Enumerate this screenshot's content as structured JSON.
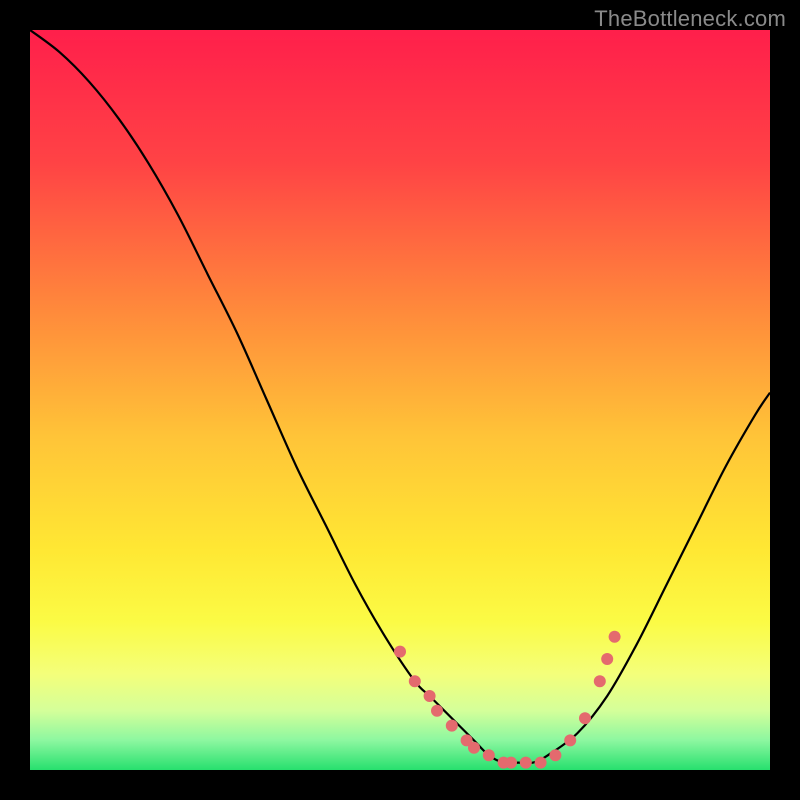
{
  "watermark": "TheBottleneck.com",
  "chart_data": {
    "type": "line",
    "title": "",
    "xlabel": "",
    "ylabel": "",
    "xlim": [
      0,
      100
    ],
    "ylim": [
      0,
      100
    ],
    "background_gradient": {
      "stops": [
        {
          "offset": 0,
          "color": "#ff1f4b"
        },
        {
          "offset": 18,
          "color": "#ff4345"
        },
        {
          "offset": 38,
          "color": "#ff8a3b"
        },
        {
          "offset": 55,
          "color": "#ffc438"
        },
        {
          "offset": 70,
          "color": "#ffe733"
        },
        {
          "offset": 80,
          "color": "#fbfb45"
        },
        {
          "offset": 87,
          "color": "#f4ff7a"
        },
        {
          "offset": 92,
          "color": "#d4ff9a"
        },
        {
          "offset": 96,
          "color": "#8cf7a0"
        },
        {
          "offset": 100,
          "color": "#27e06e"
        }
      ]
    },
    "series": [
      {
        "name": "bottleneck-curve",
        "x": [
          0,
          4,
          8,
          12,
          16,
          20,
          24,
          28,
          32,
          36,
          40,
          44,
          48,
          52,
          54,
          56,
          58,
          60,
          62,
          64,
          66,
          68,
          70,
          74,
          78,
          82,
          86,
          90,
          94,
          98,
          100
        ],
        "y": [
          100,
          97,
          93,
          88,
          82,
          75,
          67,
          59,
          50,
          41,
          33,
          25,
          18,
          12,
          10,
          8,
          6,
          4,
          2,
          1,
          1,
          1,
          2,
          5,
          10,
          17,
          25,
          33,
          41,
          48,
          51
        ]
      }
    ],
    "markers": {
      "name": "highlight-dots",
      "color": "#e46a6e",
      "radius": 6,
      "x": [
        50,
        52,
        54,
        55,
        57,
        59,
        60,
        62,
        64,
        65,
        67,
        69,
        71,
        73,
        75,
        77,
        78,
        79
      ],
      "y": [
        16,
        12,
        10,
        8,
        6,
        4,
        3,
        2,
        1,
        1,
        1,
        1,
        2,
        4,
        7,
        12,
        15,
        18
      ]
    }
  }
}
